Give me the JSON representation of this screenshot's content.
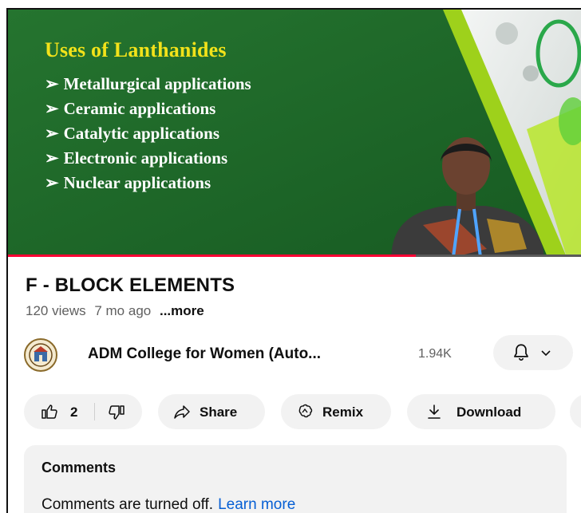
{
  "video": {
    "slide_title": "Uses of Lanthanides",
    "bullets": [
      "Metallurgical applications",
      "Ceramic applications",
      "Catalytic applications",
      "Electronic applications",
      "Nuclear applications"
    ],
    "bullet_marker": "➢",
    "progress_fraction": 0.71
  },
  "details": {
    "title": "F - BLOCK ELEMENTS",
    "views": "120 views",
    "age": "7 mo ago",
    "more_label": "...more"
  },
  "channel": {
    "name": "ADM College for Women (Auto...",
    "subscribers": "1.94K",
    "avatar_icon": "college-emblem-icon",
    "bell_icon": "bell-icon"
  },
  "actions": {
    "like_count": "2",
    "share_label": "Share",
    "remix_label": "Remix",
    "download_label": "Download"
  },
  "comments": {
    "heading": "Comments",
    "message": "Comments are turned off.",
    "link_label": "Learn more"
  },
  "colors": {
    "slide_green": "#1f6a2a",
    "slide_title": "#f2e21a",
    "progress": "#ff0033",
    "link": "#065fd4",
    "pill_bg": "#f2f2f2"
  }
}
